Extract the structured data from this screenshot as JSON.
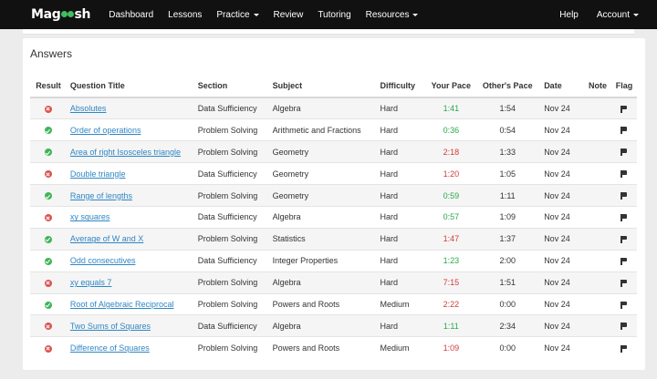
{
  "navbar": {
    "logo_left": "Mag",
    "logo_right": "sh",
    "items": [
      "Dashboard",
      "Lessons",
      "Practice",
      "Review",
      "Tutoring",
      "Resources"
    ],
    "right_items": [
      "Help",
      "Account"
    ]
  },
  "answers": {
    "title": "Answers",
    "headers": {
      "result": "Result",
      "title": "Question Title",
      "section": "Section",
      "subject": "Subject",
      "difficulty": "Difficulty",
      "your_pace": "Your Pace",
      "others_pace": "Other's Pace",
      "date": "Date",
      "note": "Note",
      "flag": "Flag"
    },
    "rows": [
      {
        "result": "wrong",
        "title": "Absolutes",
        "section": "Data Sufficiency",
        "subject": "Algebra",
        "difficulty": "Hard",
        "your_pace": "1:41",
        "pace_status": "green",
        "others_pace": "1:54",
        "date": "Nov 24"
      },
      {
        "result": "right",
        "title": "Order of operations",
        "section": "Problem Solving",
        "subject": "Arithmetic and Fractions",
        "difficulty": "Hard",
        "your_pace": "0:36",
        "pace_status": "green",
        "others_pace": "0:54",
        "date": "Nov 24"
      },
      {
        "result": "right",
        "title": "Area of right Isosceles triangle",
        "section": "Problem Solving",
        "subject": "Geometry",
        "difficulty": "Hard",
        "your_pace": "2:18",
        "pace_status": "red",
        "others_pace": "1:33",
        "date": "Nov 24"
      },
      {
        "result": "wrong",
        "title": "Double triangle",
        "section": "Data Sufficiency",
        "subject": "Geometry",
        "difficulty": "Hard",
        "your_pace": "1:20",
        "pace_status": "red",
        "others_pace": "1:05",
        "date": "Nov 24"
      },
      {
        "result": "right",
        "title": "Range of lengths",
        "section": "Problem Solving",
        "subject": "Geometry",
        "difficulty": "Hard",
        "your_pace": "0:59",
        "pace_status": "green",
        "others_pace": "1:11",
        "date": "Nov 24"
      },
      {
        "result": "wrong",
        "title": "xy squares",
        "section": "Data Sufficiency",
        "subject": "Algebra",
        "difficulty": "Hard",
        "your_pace": "0:57",
        "pace_status": "green",
        "others_pace": "1:09",
        "date": "Nov 24"
      },
      {
        "result": "right",
        "title": "Average of W and X",
        "section": "Problem Solving",
        "subject": "Statistics",
        "difficulty": "Hard",
        "your_pace": "1:47",
        "pace_status": "red",
        "others_pace": "1:37",
        "date": "Nov 24"
      },
      {
        "result": "right",
        "title": "Odd consecutives",
        "section": "Data Sufficiency",
        "subject": "Integer Properties",
        "difficulty": "Hard",
        "your_pace": "1:23",
        "pace_status": "green",
        "others_pace": "2:00",
        "date": "Nov 24"
      },
      {
        "result": "wrong",
        "title": "xy equals 7",
        "section": "Problem Solving",
        "subject": "Algebra",
        "difficulty": "Hard",
        "your_pace": "7:15",
        "pace_status": "red",
        "others_pace": "1:51",
        "date": "Nov 24"
      },
      {
        "result": "right",
        "title": "Root of Algebraic Reciprocal",
        "section": "Problem Solving",
        "subject": "Powers and Roots",
        "difficulty": "Medium",
        "your_pace": "2:22",
        "pace_status": "red",
        "others_pace": "0:00",
        "date": "Nov 24"
      },
      {
        "result": "wrong",
        "title": "Two Sums of Squares",
        "section": "Data Sufficiency",
        "subject": "Algebra",
        "difficulty": "Hard",
        "your_pace": "1:11",
        "pace_status": "green",
        "others_pace": "2:34",
        "date": "Nov 24"
      },
      {
        "result": "wrong",
        "title": "Difference of Squares",
        "section": "Problem Solving",
        "subject": "Powers and Roots",
        "difficulty": "Medium",
        "your_pace": "1:09",
        "pace_status": "red",
        "others_pace": "0:00",
        "date": "Nov 24"
      }
    ]
  },
  "colors": {
    "pace_green": "#2aa84a",
    "pace_red": "#d23b3b",
    "link": "#2f86c4",
    "navbar_bg": "#111111"
  },
  "icons": {
    "correct": "check-circle-icon",
    "incorrect": "x-circle-icon",
    "flag": "flag-icon",
    "dropdown": "caret-down-icon"
  }
}
